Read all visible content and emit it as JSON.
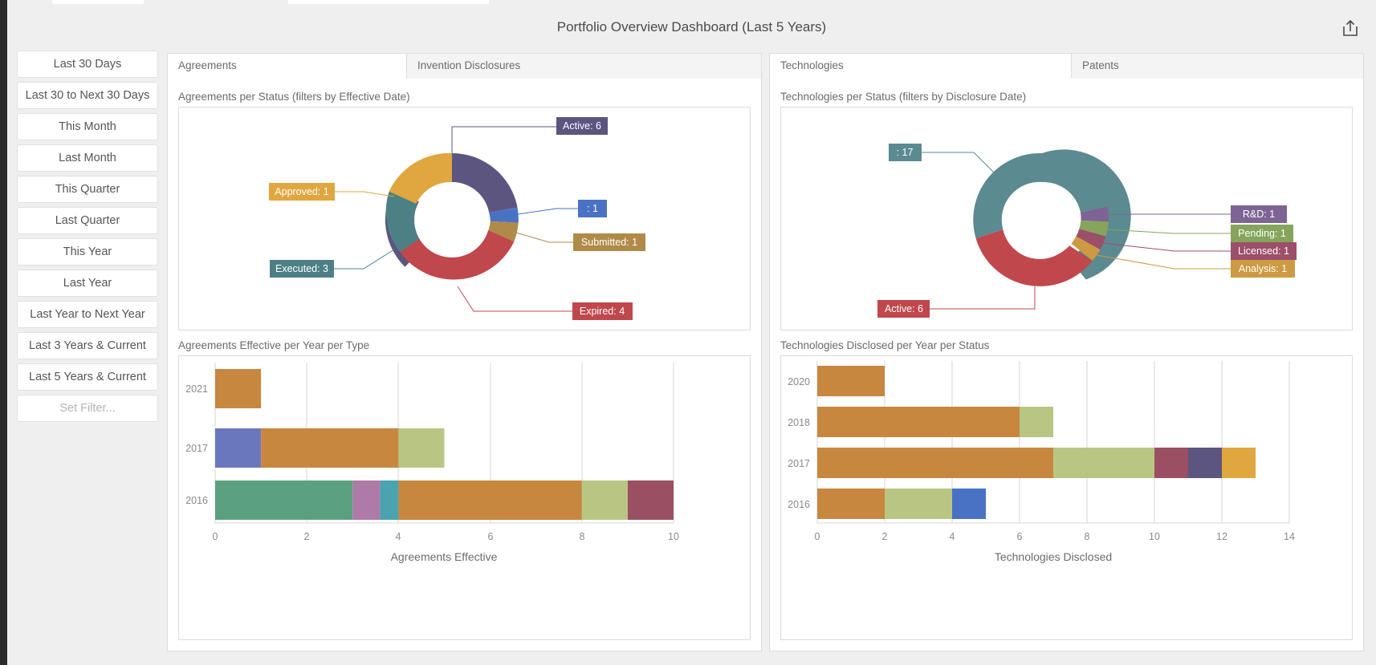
{
  "header": {
    "title": "Portfolio Overview Dashboard (Last 5 Years)",
    "export_icon": "export-share-icon"
  },
  "sidebar": {
    "items": [
      {
        "label": "Last 30 Days",
        "disabled": false
      },
      {
        "label": "Last 30 to Next 30 Days",
        "disabled": false
      },
      {
        "label": "This Month",
        "disabled": false
      },
      {
        "label": "Last Month",
        "disabled": false
      },
      {
        "label": "This Quarter",
        "disabled": false
      },
      {
        "label": "Last Quarter",
        "disabled": false
      },
      {
        "label": "This Year",
        "disabled": false
      },
      {
        "label": "Last Year",
        "disabled": false
      },
      {
        "label": "Last Year to Next Year",
        "disabled": false
      },
      {
        "label": "Last 3 Years & Current",
        "disabled": false
      },
      {
        "label": "Last 5 Years & Current",
        "disabled": false
      },
      {
        "label": "Set Filter...",
        "disabled": true
      }
    ]
  },
  "panels": {
    "left": {
      "tabs": [
        {
          "label": "Agreements",
          "active": true
        },
        {
          "label": "Invention Disclosures",
          "active": false
        }
      ],
      "donut_caption": "Agreements per Status (filters by Effective Date)",
      "bars_caption": "Agreements Effective per Year per Type"
    },
    "right": {
      "tabs": [
        {
          "label": "Technologies",
          "active": true
        },
        {
          "label": "Patents",
          "active": false
        }
      ],
      "donut_caption": "Technologies per Status (filters by Disclosure Date)",
      "bars_caption": "Technologies Disclosed per Year per Status"
    }
  },
  "chart_data": [
    {
      "id": "agreements-per-status",
      "type": "pie",
      "title": "Agreements per Status (filters by Effective Date)",
      "subtype": "donut",
      "total": 16,
      "slices": [
        {
          "label": "Active",
          "value": 6,
          "display": "Active: 6",
          "color": "#5b5580"
        },
        {
          "label": "",
          "value": 1,
          "display": ": 1",
          "color": "#4a72c4"
        },
        {
          "label": "Submitted",
          "value": 1,
          "display": "Submitted: 1",
          "color": "#b08a49"
        },
        {
          "label": "Expired",
          "value": 4,
          "display": "Expired: 4",
          "color": "#c0474c"
        },
        {
          "label": "Executed",
          "value": 3,
          "display": "Executed: 3",
          "color": "#4c8085"
        },
        {
          "label": "Approved",
          "value": 1,
          "display": "Approved: 1",
          "color": "#e0a63f"
        }
      ]
    },
    {
      "id": "technologies-per-status",
      "type": "pie",
      "title": "Technologies per Status (filters by Disclosure Date)",
      "subtype": "donut",
      "total": 27,
      "slices": [
        {
          "label": "",
          "value": 17,
          "display": ": 17",
          "color": "#5b8a91"
        },
        {
          "label": "R&D",
          "value": 1,
          "display": "R&D: 1",
          "color": "#7e6494"
        },
        {
          "label": "Pending",
          "value": 1,
          "display": "Pending: 1",
          "color": "#86a45c"
        },
        {
          "label": "Licensed",
          "value": 1,
          "display": "Licensed: 1",
          "color": "#9b4f68"
        },
        {
          "label": "Analysis",
          "value": 1,
          "display": "Analysis: 1",
          "color": "#cc9a42"
        },
        {
          "label": "Active",
          "value": 6,
          "display": "Active: 6",
          "color": "#c0474c"
        }
      ]
    },
    {
      "id": "agreements-effective-per-year-per-type",
      "type": "bar",
      "orientation": "horizontal",
      "stacked": true,
      "title": "Agreements Effective per Year per Type",
      "xlabel": "Agreements Effective",
      "ylabel": "",
      "xlim": [
        0,
        10
      ],
      "xticks": [
        0,
        2,
        4,
        6,
        8,
        10
      ],
      "grid": true,
      "categories": [
        "2021",
        "2017",
        "2016"
      ],
      "rows": [
        {
          "category": "2021",
          "segments": [
            {
              "value": 1,
              "color": "#c8873e"
            }
          ]
        },
        {
          "category": "2017",
          "segments": [
            {
              "value": 1,
              "color": "#6b77bd"
            },
            {
              "value": 3,
              "color": "#c8873e"
            },
            {
              "value": 1,
              "color": "#b9c683"
            }
          ]
        },
        {
          "category": "2016",
          "segments": [
            {
              "value": 3,
              "color": "#5ba181"
            },
            {
              "value": 0.6,
              "color": "#ae7aa8"
            },
            {
              "value": 0.4,
              "color": "#4aa3ae"
            },
            {
              "value": 4,
              "color": "#c8873e"
            },
            {
              "value": 1,
              "color": "#b9c683"
            },
            {
              "value": 1,
              "color": "#9b4f63"
            }
          ]
        }
      ]
    },
    {
      "id": "technologies-disclosed-per-year-per-status",
      "type": "bar",
      "orientation": "horizontal",
      "stacked": true,
      "title": "Technologies Disclosed per Year per Status",
      "xlabel": "Technologies Disclosed",
      "ylabel": "",
      "xlim": [
        0,
        14
      ],
      "xticks": [
        0,
        2,
        4,
        6,
        8,
        10,
        12,
        14
      ],
      "grid": true,
      "categories": [
        "2020",
        "2018",
        "2017",
        "2016"
      ],
      "rows": [
        {
          "category": "2020",
          "segments": [
            {
              "value": 2,
              "color": "#c8873e"
            }
          ]
        },
        {
          "category": "2018",
          "segments": [
            {
              "value": 6,
              "color": "#c8873e"
            },
            {
              "value": 1,
              "color": "#b9c683"
            }
          ]
        },
        {
          "category": "2017",
          "segments": [
            {
              "value": 7,
              "color": "#c8873e"
            },
            {
              "value": 3,
              "color": "#b9c683"
            },
            {
              "value": 1,
              "color": "#9b4f63"
            },
            {
              "value": 1,
              "color": "#5b5580"
            },
            {
              "value": 1,
              "color": "#e0a63f"
            }
          ]
        },
        {
          "category": "2016",
          "segments": [
            {
              "value": 2,
              "color": "#c8873e"
            },
            {
              "value": 2,
              "color": "#b9c683"
            },
            {
              "value": 1,
              "color": "#4a72c4"
            }
          ]
        }
      ]
    }
  ]
}
